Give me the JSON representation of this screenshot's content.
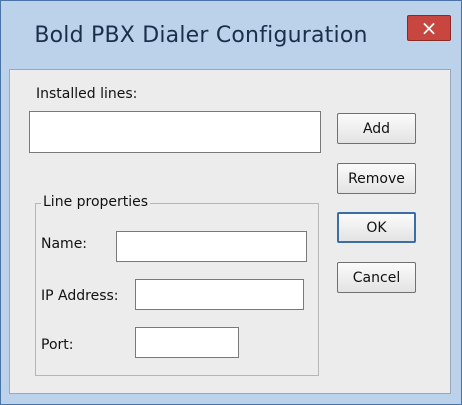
{
  "window": {
    "title": "Bold PBX Dialer Configuration",
    "close_glyph": "×"
  },
  "labels": {
    "installed_lines": "Installed lines:",
    "line_properties": "Line properties",
    "name": "Name:",
    "ip_address": "IP Address:",
    "port": "Port:"
  },
  "buttons": {
    "add": "Add",
    "remove": "Remove",
    "ok": "OK",
    "cancel": "Cancel"
  },
  "fields": {
    "name_value": "",
    "ip_address_value": "",
    "port_value": ""
  },
  "installed_lines": [],
  "colors": {
    "title_bar": "#bcd1ea",
    "close_button": "#c7463f",
    "client_bg": "#ececec"
  }
}
